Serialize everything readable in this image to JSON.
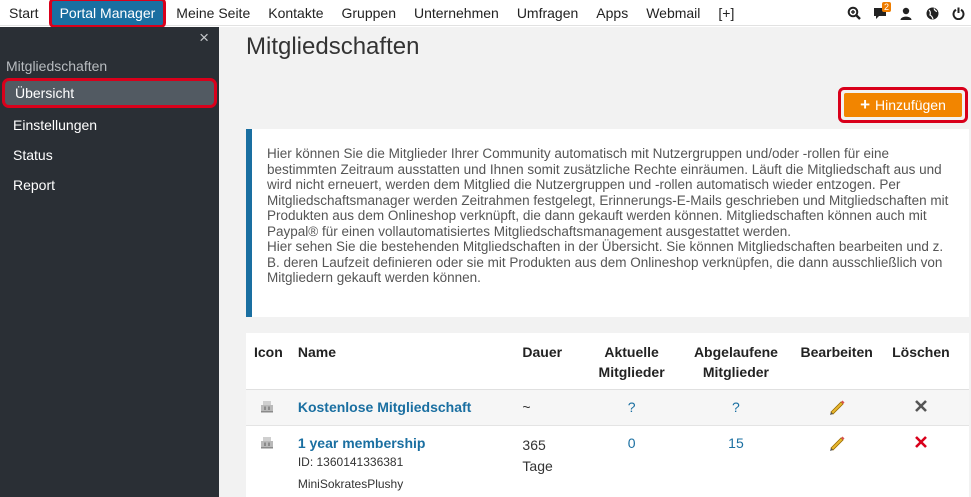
{
  "nav": {
    "items": [
      "Start",
      "Portal Manager",
      "Meine Seite",
      "Kontakte",
      "Gruppen",
      "Unternehmen",
      "Umfragen",
      "Apps",
      "Webmail",
      "[+]"
    ],
    "active_index": 1,
    "icons": [
      "search-plus-icon",
      "chat-icon",
      "user-icon",
      "globe-icon",
      "power-icon"
    ],
    "message_badge": "2"
  },
  "sidebar": {
    "close_glyph": "×",
    "header": "Mitgliedschaften",
    "items": [
      {
        "label": "Übersicht",
        "active": true
      },
      {
        "label": "Einstellungen",
        "active": false
      },
      {
        "label": "Status",
        "active": false
      },
      {
        "label": "Report",
        "active": false
      }
    ]
  },
  "page": {
    "title": "Mitgliedschaften",
    "add_button": "Hinzufügen",
    "add_icon": "plus-icon",
    "info_text_1": "Hier können Sie die Mitglieder Ihrer Community automatisch mit Nutzergruppen und/oder -rollen für eine bestimmten Zeitraum ausstatten und Ihnen somit zusätzliche Rechte einräumen. Läuft die Mitgliedschaft aus und wird nicht erneuert, werden dem Mitglied die Nutzergruppen und -rollen automatisch wieder entzogen. Per Mitgliedschaftsmanager werden Zeitrahmen festgelegt, Erinnerungs-E-Mails geschrieben und Mitgliedschaften mit Produkten aus dem Onlineshop verknüpft, die dann gekauft werden können. Mitgliedschaften können auch mit Paypal® für einen vollautomatisiertes Mitgliedschaftsmanagement ausgestattet werden.",
    "info_text_2": "Hier sehen Sie die bestehenden Mitgliedschaften in der Übersicht. Sie können Mitgliedschaften bearbeiten und z. B. deren Laufzeit definieren oder sie mit Produkten aus dem Onlineshop verknüpfen, die dann ausschließlich von Mitgliedern gekauft werden können."
  },
  "table": {
    "headers": {
      "icon": "Icon",
      "name": "Name",
      "duration": "Dauer",
      "current_1": "Aktuelle",
      "current_2": "Mitglieder",
      "expired_1": "Abgelaufene",
      "expired_2": "Mitglieder",
      "edit": "Bearbeiten",
      "delete": "Löschen"
    },
    "rows": [
      {
        "name": "Kostenlose Mitgliedschaft",
        "id": "",
        "extra": "",
        "duration_1": "~",
        "duration_2": "",
        "current": "?",
        "expired": "?",
        "delete_color": "#555555"
      },
      {
        "name": "1 year membership",
        "id": "ID: 1360141336381",
        "extra": "MiniSokratesPlushy",
        "duration_1": "365",
        "duration_2": "Tage",
        "current": "0",
        "expired": "15",
        "delete_color": "#d9001b"
      }
    ]
  },
  "colors": {
    "brand": "#1a6fa1",
    "accent": "#f28500",
    "highlight": "#d9001b"
  }
}
